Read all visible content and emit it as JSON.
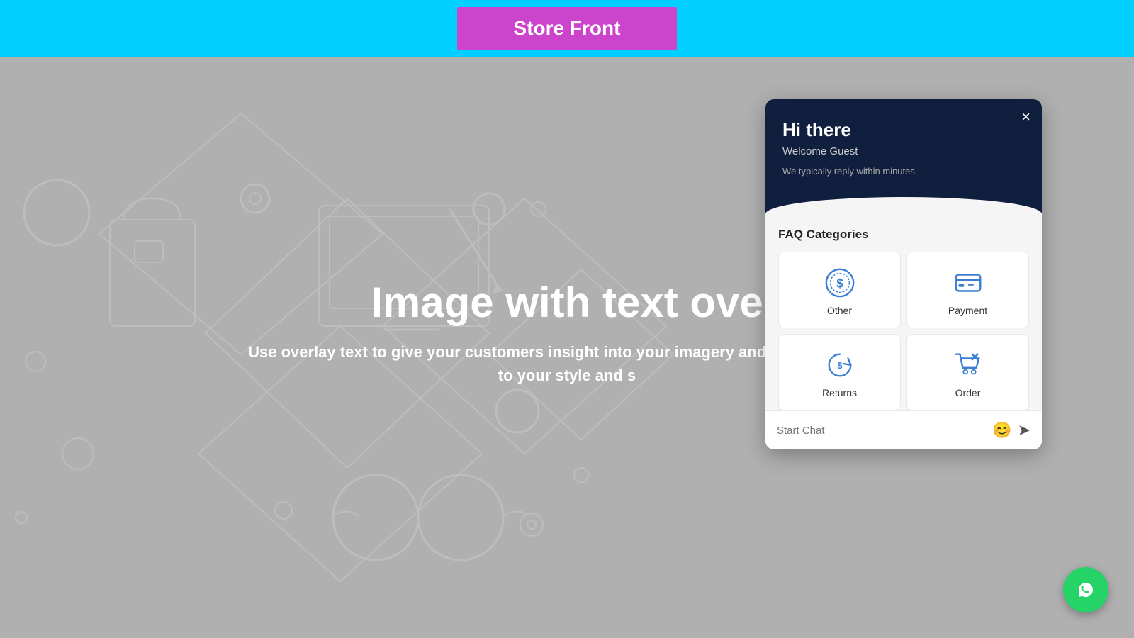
{
  "topbar": {
    "background_color": "#00cfff",
    "button_label": "Store Front",
    "button_color": "#cc44cc"
  },
  "overlay": {
    "heading": "Image with text ove",
    "subtext": "Use overlay text to give your customers insight into your\nimagery and text that relates to your style and s"
  },
  "chat": {
    "close_label": "×",
    "greeting": "Hi there",
    "welcome": "Welcome Guest",
    "reply_time": "We typically reply within minutes",
    "faq_title": "FAQ Categories",
    "categories": [
      {
        "id": "other",
        "label": "Other",
        "icon": "dollar-circle"
      },
      {
        "id": "payment",
        "label": "Payment",
        "icon": "credit-card"
      },
      {
        "id": "returns",
        "label": "Returns",
        "icon": "dollar-refresh"
      },
      {
        "id": "order",
        "label": "Order",
        "icon": "shopping-cart-x"
      }
    ],
    "input_placeholder": "Start Chat",
    "emoji_icon": "😊",
    "send_icon": "➤"
  },
  "whatsapp": {
    "aria": "WhatsApp Chat"
  }
}
